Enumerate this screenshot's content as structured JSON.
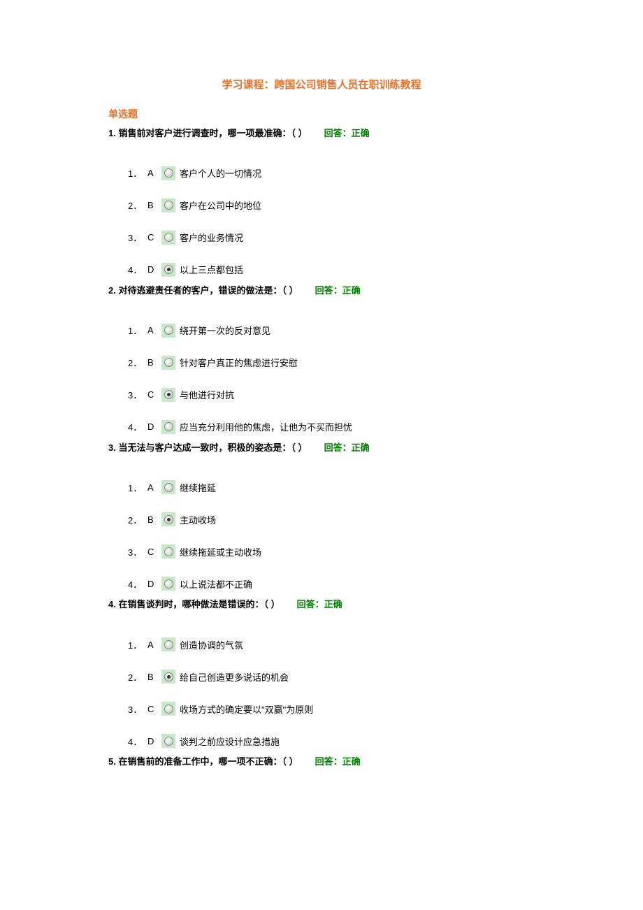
{
  "course_title": "学习课程：跨国公司销售人员在职训练教程",
  "section_header": "单选题",
  "feedback_label": "回答：正确",
  "questions": [
    {
      "number": "1.",
      "text": "销售前对客户进行调查时，哪一项最准确：（ ）",
      "selected_index": 3,
      "options": [
        {
          "idx": "1．",
          "letter": "A",
          "text": "客户个人的一切情况"
        },
        {
          "idx": "2．",
          "letter": "B",
          "text": "客户在公司中的地位"
        },
        {
          "idx": "3．",
          "letter": "C",
          "text": "客户的业务情况"
        },
        {
          "idx": "4．",
          "letter": "D",
          "text": "以上三点都包括"
        }
      ]
    },
    {
      "number": "2.",
      "text": "对待逃避责任者的客户，错误的做法是：（ ）",
      "selected_index": 2,
      "options": [
        {
          "idx": "1．",
          "letter": "A",
          "text": "绕开第一次的反对意见"
        },
        {
          "idx": "2．",
          "letter": "B",
          "text": "针对客户真正的焦虑进行安慰"
        },
        {
          "idx": "3．",
          "letter": "C",
          "text": "与他进行对抗"
        },
        {
          "idx": "4．",
          "letter": "D",
          "text": "应当充分利用他的焦虑，让他为不买而担忧"
        }
      ]
    },
    {
      "number": "3.",
      "text": "当无法与客户达成一致时，积极的姿态是：（ ）",
      "selected_index": 1,
      "options": [
        {
          "idx": "1．",
          "letter": "A",
          "text": "继续拖延"
        },
        {
          "idx": "2．",
          "letter": "B",
          "text": "主动收场"
        },
        {
          "idx": "3．",
          "letter": "C",
          "text": "继续拖延或主动收场"
        },
        {
          "idx": "4．",
          "letter": "D",
          "text": "以上说法都不正确"
        }
      ]
    },
    {
      "number": "4.",
      "text": "在销售谈判时，哪种做法是错误的：（ ）",
      "selected_index": 1,
      "options": [
        {
          "idx": "1．",
          "letter": "A",
          "text": "创造协调的气氛"
        },
        {
          "idx": "2．",
          "letter": "B",
          "text": "给自己创造更多说话的机会"
        },
        {
          "idx": "3．",
          "letter": "C",
          "text": "收场方式的确定要以\"双赢\"为原则"
        },
        {
          "idx": "4．",
          "letter": "D",
          "text": "谈判之前应设计应急措施"
        }
      ]
    },
    {
      "number": "5.",
      "text": "在销售前的准备工作中，哪一项不正确：（ ）",
      "selected_index": -1,
      "options": []
    }
  ]
}
